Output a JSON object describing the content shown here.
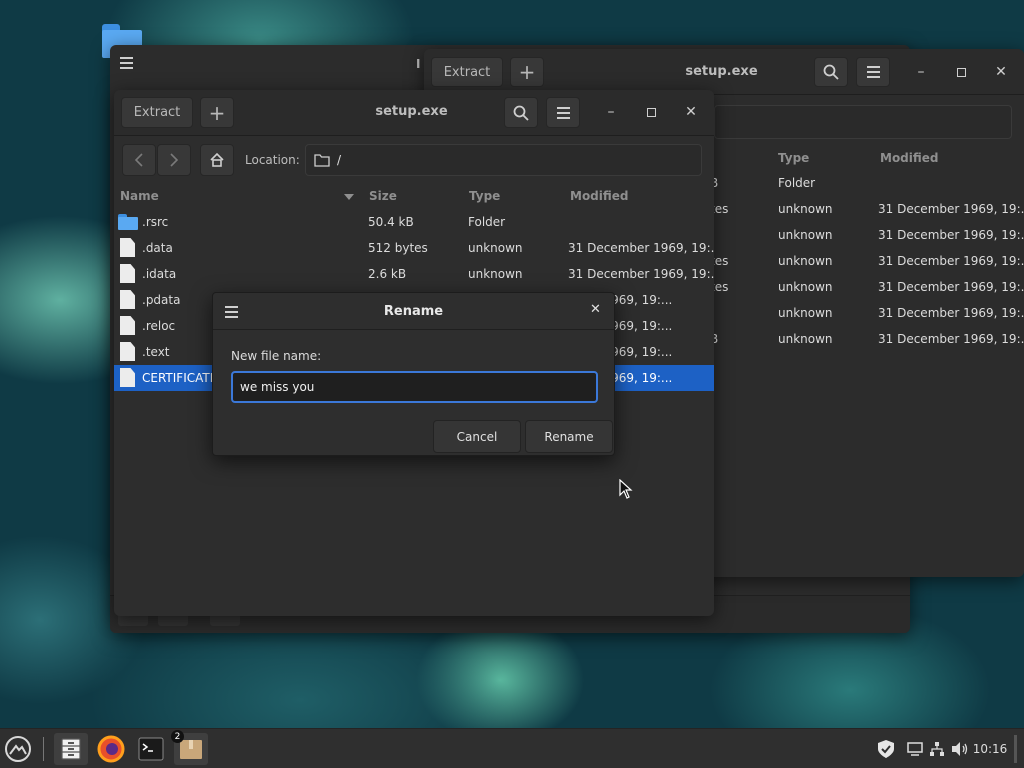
{
  "back_window": {
    "title": "setup.exe",
    "extract_label": "Extract",
    "partial_title_glyph": "I",
    "columns": {
      "type": "Type",
      "modified": "Modified"
    },
    "rows": [
      {
        "size_frag": "B",
        "type": "Folder",
        "modified": ""
      },
      {
        "size_frag": "tes",
        "type": "unknown",
        "modified": "31 December 1969, 19:..."
      },
      {
        "size_frag": "",
        "type": "unknown",
        "modified": "31 December 1969, 19:..."
      },
      {
        "size_frag": "tes",
        "type": "unknown",
        "modified": "31 December 1969, 19:..."
      },
      {
        "size_frag": "tes",
        "type": "unknown",
        "modified": "31 December 1969, 19:..."
      },
      {
        "size_frag": "",
        "type": "unknown",
        "modified": "31 December 1969, 19:..."
      },
      {
        "size_frag": "B",
        "type": "unknown",
        "modified": "31 December 1969, 19:..."
      }
    ]
  },
  "front_window": {
    "title": "setup.exe",
    "extract_label": "Extract",
    "location_label": "Location:",
    "location_path": "/",
    "columns": {
      "name": "Name",
      "size": "Size",
      "type": "Type",
      "modified": "Modified"
    },
    "rows": [
      {
        "name": ".rsrc",
        "size": "50.4 kB",
        "type": "Folder",
        "modified": "",
        "icon": "folder-icon"
      },
      {
        "name": ".data",
        "size": "512 bytes",
        "type": "unknown",
        "modified": "31 December 1969, 19:...",
        "icon": "file-icon"
      },
      {
        "name": ".idata",
        "size": "2.6 kB",
        "type": "unknown",
        "modified": "31 December 1969, 19:...",
        "icon": "file-icon"
      },
      {
        "name": ".pdata",
        "size": "",
        "type": "",
        "modified": "mber 1969, 19:...",
        "icon": "file-icon"
      },
      {
        "name": ".reloc",
        "size": "",
        "type": "",
        "modified": "mber 1969, 19:...",
        "icon": "file-icon"
      },
      {
        "name": ".text",
        "size": "",
        "type": "",
        "modified": "mber 1969, 19:...",
        "icon": "file-icon"
      },
      {
        "name": "CERTIFICATE",
        "size": "",
        "type": "",
        "modified": "mber 1969, 19:...",
        "icon": "file-icon",
        "selected": true
      }
    ]
  },
  "dialog": {
    "title": "Rename",
    "label": "New file name:",
    "value": "we miss you",
    "cancel_label": "Cancel",
    "rename_label": "Rename"
  },
  "taskbar": {
    "notification_count": "2",
    "clock": "10:16"
  },
  "colors": {
    "selection": "#1d61c5",
    "focus_border": "#3b78d8",
    "window_bg": "#2d2d2d"
  }
}
